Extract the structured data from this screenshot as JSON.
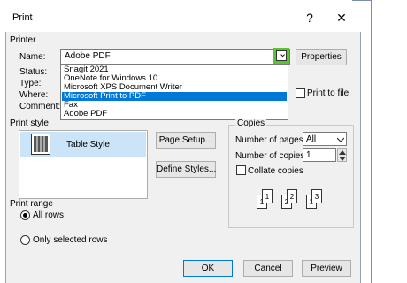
{
  "window": {
    "title": "Print",
    "help_label": "?",
    "close_label": "✕"
  },
  "printer": {
    "group_label": "Printer",
    "name_label": "Name:",
    "name_value": "Adobe PDF",
    "properties_label": "Properties",
    "status_label": "Status:",
    "type_label": "Type:",
    "where_label": "Where:",
    "comment_label": "Comment:",
    "print_to_file_label": "Print to file",
    "dropdown_arrow": "⌄",
    "options": [
      "Snagit 2021",
      "OneNote for Windows 10",
      "Microsoft XPS Document Writer",
      "Microsoft Print to PDF",
      "Fax",
      "Adobe PDF"
    ],
    "highlighted_index": 3
  },
  "print_style": {
    "group_label": "Print style",
    "selected_style": "Table Style",
    "page_setup_label": "Page Setup...",
    "define_styles_label": "Define Styles..."
  },
  "copies": {
    "group_label": "Copies",
    "pages_label": "Number of pages:",
    "pages_value": "All",
    "copies_label": "Number of copies:",
    "copies_value": "1",
    "collate_label": "Collate copies",
    "collate_checked": false,
    "page_numbers": [
      "1",
      "1",
      "2",
      "2",
      "3",
      "3"
    ]
  },
  "print_range": {
    "group_label": "Print range",
    "all_rows_label": "All rows",
    "selected_rows_label": "Only selected rows"
  },
  "footer": {
    "ok_label": "OK",
    "cancel_label": "Cancel",
    "preview_label": "Preview"
  },
  "colors": {
    "accent": "#0078d7",
    "highlight_green": "#5bc236",
    "selection_bg": "#cce4f7"
  }
}
